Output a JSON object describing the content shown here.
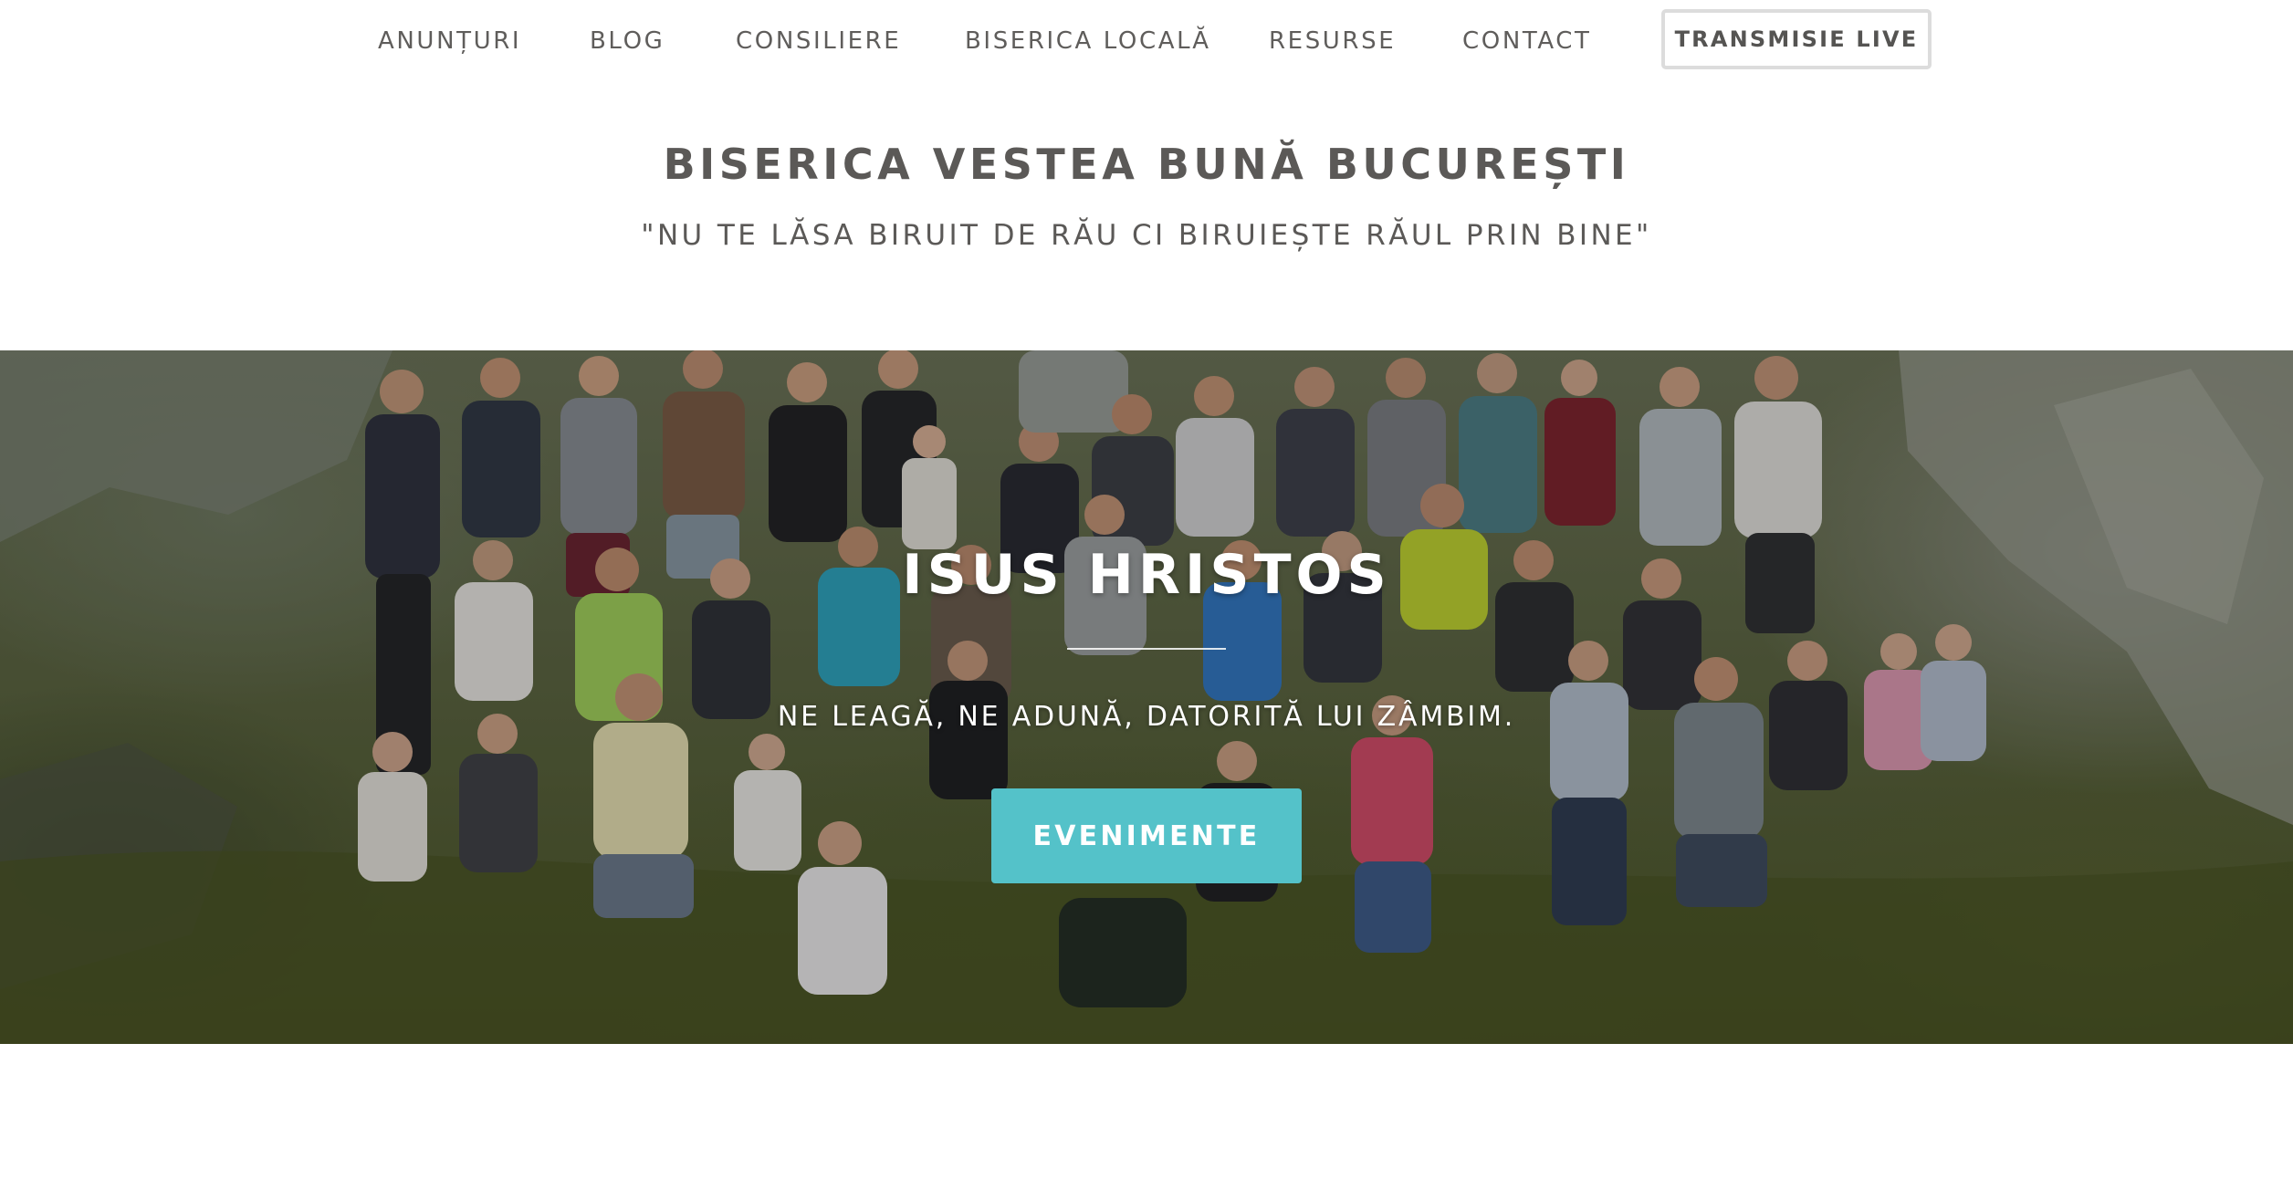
{
  "nav": {
    "items": [
      {
        "label": "ANUNȚURI"
      },
      {
        "label": "BLOG"
      },
      {
        "label": "CONSILIERE"
      },
      {
        "label": "BISERICA LOCALĂ"
      },
      {
        "label": "RESURSE"
      },
      {
        "label": "CONTACT"
      }
    ],
    "live_label": "TRANSMISIE LIVE"
  },
  "header": {
    "title": "BISERICA VESTEA BUNĂ BUCUREȘTI",
    "motto": "\"NU TE LĂSA BIRUIT DE RĂU CI BIRUIEȘTE RĂUL PRIN BINE\""
  },
  "hero": {
    "heading": "ISUS HRISTOS",
    "subtitle": "NE LEAGĂ, NE ADUNĂ, DATORITĂ LUI ZÂMBIM.",
    "button_label": "EVENIMENTE",
    "photo": "group-photo-on-mountain-hillside"
  },
  "colors": {
    "text": "#5a5856",
    "accent_button": "#54c2c9",
    "live_border": "#dcdcdc"
  }
}
